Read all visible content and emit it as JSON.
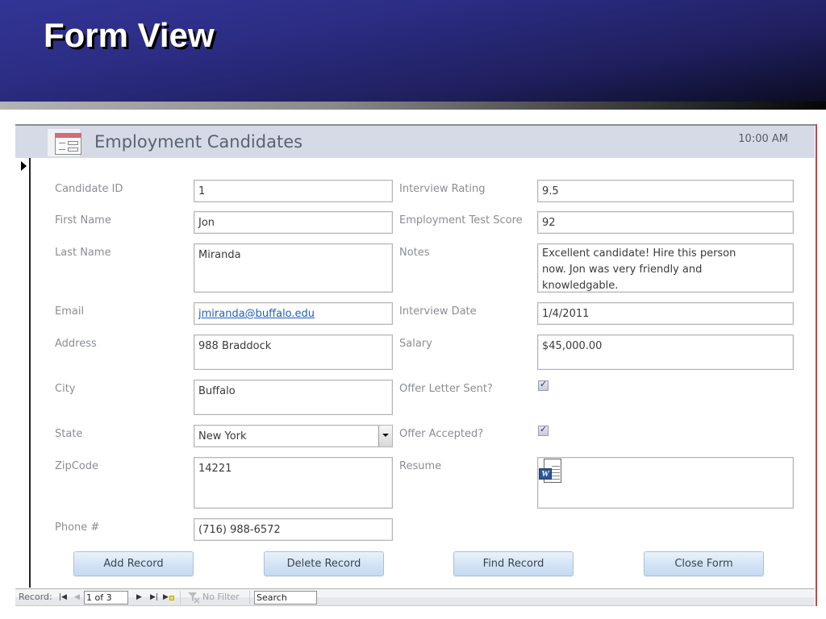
{
  "slide": {
    "title": "Form View"
  },
  "form": {
    "title": "Employment Candidates",
    "icon": "form-icon",
    "time": "10:00 AM",
    "left_fields": [
      {
        "label": "Candidate ID",
        "value": "1"
      },
      {
        "label": "First Name",
        "value": "Jon"
      },
      {
        "label": "Last Name",
        "value": "Miranda"
      },
      {
        "label": "Email",
        "value": "jmiranda@buffalo.edu"
      },
      {
        "label": "Address",
        "value": "988 Braddock"
      },
      {
        "label": "City",
        "value": "Buffalo"
      },
      {
        "label": "State",
        "value": "New York"
      },
      {
        "label": "ZipCode",
        "value": "14221"
      },
      {
        "label": "Phone #",
        "value": "(716) 988-6572"
      }
    ],
    "right_fields": [
      {
        "label": "Interview Rating",
        "value": "9.5"
      },
      {
        "label": "Employment Test Score",
        "value": "92"
      },
      {
        "label": "Notes",
        "value": "Excellent candidate!  Hire this person now.   Jon was very friendly and knowledgable."
      },
      {
        "label": "Interview Date",
        "value": "1/4/2011"
      },
      {
        "label": "Salary",
        "value": "$45,000.00"
      },
      {
        "label": "Offer Letter Sent?",
        "checked": true,
        "mark": "✓"
      },
      {
        "label": "Offer Accepted?",
        "checked": true,
        "mark": "✓"
      },
      {
        "label": "Resume",
        "attachment_icon": "word-document-icon",
        "attachment_glyph": "W"
      }
    ],
    "buttons": {
      "add": "Add Record",
      "delete": "Delete Record",
      "find": "Find Record",
      "close": "Close Form"
    },
    "navigation": {
      "label": "Record:",
      "current": "1 of 3",
      "filter": "No Filter",
      "search": "Search",
      "icons": {
        "first": "⏮",
        "prev": "◀",
        "next": "▶",
        "last": "⏭",
        "new": "▶"
      }
    }
  },
  "colors": {
    "header_blue": "#2b2c82",
    "form_header_bg": "#d6dae6",
    "button_bg": "#d4e4f6",
    "link": "#1f5fbf"
  }
}
